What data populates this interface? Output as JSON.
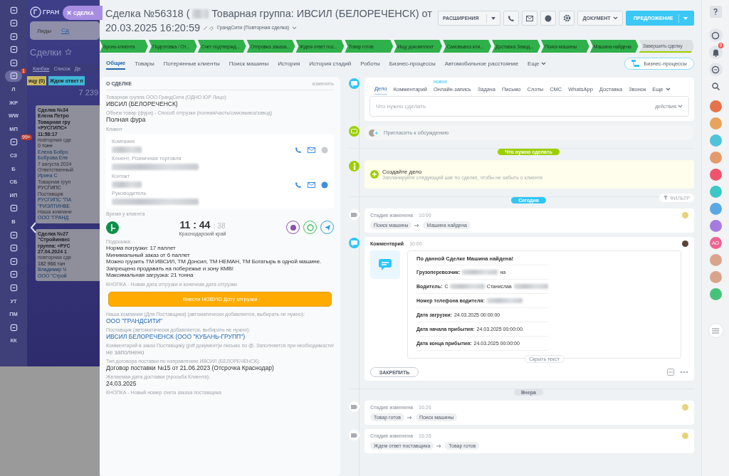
{
  "background_app": {
    "logo": "ГРАН",
    "nav": [
      {
        "kind": "icon",
        "selected": false
      },
      {
        "kind": "icon",
        "selected": false
      },
      {
        "kind": "icon",
        "selected": false
      },
      {
        "kind": "icon",
        "selected": false
      },
      {
        "kind": "icon",
        "selected": false
      },
      {
        "kind": "icon",
        "badge": "1",
        "selected": true
      },
      {
        "kind": "text",
        "label": "Л",
        "selected": false
      },
      {
        "kind": "text",
        "label": "ЖР",
        "selected": false
      },
      {
        "kind": "text",
        "label": "WW",
        "selected": false
      },
      {
        "kind": "text",
        "label": "МП",
        "selected": false
      },
      {
        "kind": "icon",
        "badge": "99+",
        "selected": false
      },
      {
        "kind": "text",
        "label": "СЗ",
        "selected": false
      },
      {
        "kind": "text",
        "label": "Б",
        "selected": false
      },
      {
        "kind": "text",
        "label": "СБ",
        "selected": false
      },
      {
        "kind": "text",
        "label": "ИП",
        "selected": false
      },
      {
        "kind": "icon",
        "selected": false
      },
      {
        "kind": "text",
        "label": "В",
        "selected": false
      },
      {
        "kind": "icon",
        "selected": false
      },
      {
        "kind": "icon",
        "selected": false
      },
      {
        "kind": "icon",
        "selected": false
      },
      {
        "kind": "icon",
        "selected": false
      },
      {
        "kind": "icon",
        "selected": false
      },
      {
        "kind": "text",
        "label": "УТ",
        "selected": false
      },
      {
        "kind": "text",
        "label": "ПМ",
        "selected": false
      },
      {
        "kind": "icon",
        "selected": false
      },
      {
        "kind": "text",
        "label": "КК",
        "selected": false
      }
    ],
    "tabs": [
      {
        "label": "Лиды",
        "selected": false
      },
      {
        "label": "Сд",
        "selected": true
      }
    ],
    "title": "Сделки",
    "views": [
      {
        "label": "Канбан",
        "selected": true
      },
      {
        "label": "Список",
        "selected": false
      },
      {
        "label": "Де",
        "selected": false
      }
    ],
    "columns": [
      {
        "label": "ицу (0)",
        "color": "#c8b85e"
      },
      {
        "label": "Ждем ответ п",
        "color": "#3fb6d6"
      }
    ],
    "column_total": "7 239",
    "cards": [
      {
        "lines": [
          {
            "kind": "title",
            "text": "Сделка №34"
          },
          {
            "kind": "title",
            "text": "Елена Петро"
          },
          {
            "kind": "title",
            "text": "Товарная гру"
          },
          {
            "kind": "title",
            "text": "«РУСГИПС»"
          },
          {
            "kind": "title",
            "text": "11:58:17"
          },
          {
            "kind": "muted",
            "text": "повторная сде"
          },
          {
            "kind": "plain",
            "text": "0 тонн"
          },
          {
            "kind": "link",
            "text": "Елена Бобро"
          },
          {
            "kind": "link",
            "text": "Боброва Еле"
          },
          {
            "kind": "muted",
            "text": "7 августа 2024"
          },
          {
            "kind": "muted",
            "text": "Ответственный"
          },
          {
            "kind": "person",
            "text": "Ирина С"
          },
          {
            "kind": "muted",
            "text": "Товарная груп"
          },
          {
            "kind": "plain",
            "text": "РУСГИПС"
          },
          {
            "kind": "muted",
            "text": "Поставщик"
          },
          {
            "kind": "link",
            "text": "РУСГИПС \"ПА"
          },
          {
            "kind": "link",
            "text": "\"РИЭЛТИНВЕ"
          },
          {
            "kind": "muted",
            "text": "Наша компани"
          },
          {
            "kind": "link",
            "text": "ООО \"ГРАНД"
          }
        ]
      },
      {
        "lines": [
          {
            "kind": "title",
            "text": "Сделка №27"
          },
          {
            "kind": "title",
            "text": "\"Стройинвес"
          },
          {
            "kind": "title",
            "text": "группа: «РУС"
          },
          {
            "kind": "title",
            "text": "27.04.2024 1"
          },
          {
            "kind": "muted",
            "text": "повторная сде"
          },
          {
            "kind": "plain",
            "text": "182 966 тон"
          },
          {
            "kind": "link",
            "text": "Владимир Ч"
          },
          {
            "kind": "link",
            "text": "ООО \"Строй"
          }
        ]
      }
    ]
  },
  "close_tab": {
    "label": "СДЕЛКА"
  },
  "deal": {
    "title_start": "Сделка №56318 (",
    "title_end": "Товарная группа: ИВСИЛ (БЕЛОРЕЧЕНСК) от",
    "title_date": "20.03.2025 16:20:59",
    "category": "ГрандСити (Повторная сделка)"
  },
  "toolbar": {
    "extensions": "РАСШИРЕНИЯ",
    "document": "ДОКУМЕНТ",
    "primary": "ПРЕДЛОЖЕНИЕ"
  },
  "stages": [
    {
      "label": "Бронь клиента",
      "passed": true
    },
    {
      "label": "Подготовка / От...",
      "passed": true
    },
    {
      "label": "Счет подтвержд...",
      "passed": true
    },
    {
      "label": "Отправка заказа...",
      "passed": true
    },
    {
      "label": "Ждем ответ пос...",
      "passed": true
    },
    {
      "label": "Товар готов",
      "passed": true
    },
    {
      "label": "Ищу докомплект",
      "passed": true
    },
    {
      "label": "Самовывоз кли...",
      "passed": true
    },
    {
      "label": "Доставка Завод...",
      "passed": true
    },
    {
      "label": "Поиск машины",
      "passed": true
    },
    {
      "label": "Машина найдена",
      "passed": true
    },
    {
      "label": "Завершить сделку",
      "passed": false
    }
  ],
  "tabs": [
    {
      "label": "Общие",
      "selected": true
    },
    {
      "label": "Товары",
      "selected": false
    },
    {
      "label": "Потерянные клиенты",
      "selected": false
    },
    {
      "label": "Поиск машины",
      "selected": false
    },
    {
      "label": "История",
      "selected": false
    },
    {
      "label": "История стадий",
      "selected": false
    },
    {
      "label": "Роботы",
      "selected": false
    },
    {
      "label": "Бизнес-процессы",
      "selected": false
    },
    {
      "label": "Автомобильное расстояние",
      "selected": false
    },
    {
      "label": "Еще",
      "selected": false
    }
  ],
  "bp_button": "Бизнес-процессы",
  "about": {
    "title": "О СДЕЛКЕ",
    "edit": "изменить",
    "top_fields": [
      {
        "label": "Товарная группа ООО ГрандСити (ОДНО ЮР Лицо):",
        "value": "ИВСИЛ (БЕЛОРЕЧЕНСК)"
      },
      {
        "label": "Объем товар (фура) - Способ отгрузки (полная/часть/самовывоз/завод)",
        "value": "Полная фура"
      }
    ],
    "client_label": "Клиент",
    "client": [
      {
        "label": "Компания",
        "role": "Клиент, Розничная торговля",
        "messenger_active": false
      },
      {
        "label": "Контакт",
        "role": "Руководитель",
        "messenger_active": true
      }
    ],
    "time_label": "Время у клиента",
    "time_main": "11 : 44",
    "time_seconds": ": 38",
    "region": "Краснодарский край",
    "hint_label": "Подсказка:",
    "hint_lines": [
      "Норма погрузки: 17 паллет",
      "Минимальный заказ от 6 паллет",
      "Можно грузить ТМ ИВСИЛ, ТМ Донсил, ТМ НЕМАН, ТМ Богатырь в одной машине.",
      "Запрещено продавать на побережье и зону КМВ!",
      "Максимальная загрузка: 21 тонна"
    ],
    "button_label": "КНОПКА - Новая дата отгрузки и конечная дата отгрузки",
    "button": "Внести НОВУЮ Доту отгрузки",
    "fields": [
      {
        "label": "Наша компания (Для Поставщика) (автоматически добавляется, выбирать не нужно):",
        "value": "ООО \"ГРАНДСИТИ\"",
        "kind": "link"
      },
      {
        "label": "Поставщик (автоматически добавляется, выбирать не нужно):",
        "value": "ИВСИЛ БЕЛОРЕЧЕНСК (ООО \"КУБАНЬ-ГРУПП\")",
        "kind": "link"
      },
      {
        "label": "Комментарий в заказ Поставщику (pdf документ)и письмо по @. Заполняется при необходимости!",
        "value": "не заполнено",
        "kind": "empty"
      },
      {
        "label": "Тип договора поставки по направлению ИВСИЛ (БЕЛОРЕЧЕНСК):",
        "value": "Договор поставки №15 от 21.06.2023 (Отсрочка Краснодар)",
        "kind": "text"
      },
      {
        "label": "Желаемая дата доставки (просьба Клиента):",
        "value": "24.03.2025",
        "kind": "text"
      },
      {
        "label": "КНОПКА - Новый номер счета заказа поставщика"
      }
    ]
  },
  "composer": {
    "tabs": [
      {
        "label": "Дело",
        "selected": true
      },
      {
        "label": "Комментарий",
        "selected": false
      },
      {
        "label": "Онлайн-запись",
        "badge": "новое",
        "selected": false
      },
      {
        "label": "Задача",
        "selected": false
      },
      {
        "label": "Письмо",
        "selected": false
      },
      {
        "label": "Слоты",
        "selected": false
      },
      {
        "label": "СМС",
        "selected": false
      },
      {
        "label": "WhatsApp",
        "selected": false
      },
      {
        "label": "Доставка",
        "selected": false
      },
      {
        "label": "Звонок",
        "selected": false
      },
      {
        "label": "Еще",
        "selected": false
      }
    ],
    "placeholder": "Что нужно сделать",
    "actions": "действия"
  },
  "invite": "Пригласить к обсуждению",
  "timeline": [
    {
      "kind": "separator",
      "label": "Что нужно сделать",
      "color": "#9dcf00"
    },
    {
      "kind": "todo",
      "title": "Создайте дело",
      "text": "Запланируйте следующий шаг по сделке, чтобы не забыть о клиенте"
    },
    {
      "kind": "separator",
      "label": "Сегодня",
      "color": "#2fc6f6",
      "filter": "ФИЛЬТР"
    },
    {
      "kind": "stage",
      "title": "Стадия изменена",
      "time": "10:00",
      "from": "Поиск машины",
      "to": "Машина найдена"
    },
    {
      "kind": "comment",
      "title": "Комментарий",
      "time": "10:00",
      "heading": "По данной Сделке Машина найдена!",
      "lines": [
        [
          {
            "kind": "bold",
            "text": "Грузоперевозчик:"
          },
          {
            "kind": "blur"
          },
          {
            "kind": "text",
            "text": "на"
          }
        ],
        [
          {
            "kind": "bold",
            "text": "Водитель:"
          },
          {
            "kind": "text",
            "text": "С"
          },
          {
            "kind": "blur"
          },
          {
            "kind": "text",
            "text": "Станислав"
          },
          {
            "kind": "blur"
          }
        ],
        [
          {
            "kind": "bold",
            "text": "Номер телефона водителя:"
          },
          {
            "kind": "blur"
          }
        ],
        [
          {
            "kind": "bold",
            "text": "Дата загрузки:"
          },
          {
            "kind": "text",
            "text": "24.03.2025 00:00:00"
          }
        ],
        [
          {
            "kind": "bold",
            "text": "Дата начала прибытия:"
          },
          {
            "kind": "text",
            "text": "24.03.2025 00:00:00."
          }
        ],
        [
          {
            "kind": "bold",
            "text": "Дата конца прибытия:"
          },
          {
            "kind": "text",
            "text": "24.03.2025 00:00:00"
          }
        ]
      ],
      "collapse": "Скрыть текст",
      "pin": "ЗАКРЕПИТЬ"
    },
    {
      "kind": "separator",
      "label": "Вчера",
      "color": "#dfe3e8"
    },
    {
      "kind": "stage",
      "title": "Стадия изменена",
      "time": "16:26",
      "from": "Товар готов",
      "to": "Поиск машины"
    },
    {
      "kind": "stage",
      "title": "Стадия изменена",
      "time": "16:26",
      "from": "Ждем ответ поставщика",
      "to": "Товар готов"
    }
  ],
  "right_bar": {
    "notifications": "9",
    "avatar": "АО",
    "apps": [
      {
        "color": "#e8734a"
      },
      {
        "color": "#e8a35c"
      },
      {
        "color": "#4fc3d9"
      },
      {
        "color": "#e59a6b"
      },
      {
        "color": "#f0546c"
      },
      {
        "color": "#3bc8c6"
      },
      {
        "color": "#5aa8e6"
      },
      {
        "color": "#a77ce0"
      }
    ],
    "apps_after": [
      {
        "color": "#d9a48c"
      },
      {
        "color": "#d9a48c"
      },
      {
        "color": "#47c27a"
      }
    ]
  }
}
